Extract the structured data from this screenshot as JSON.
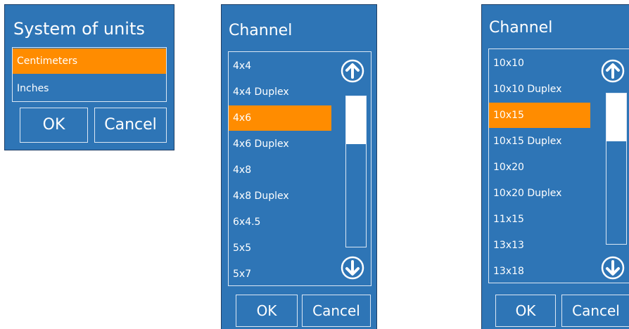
{
  "units_dialog": {
    "title": "System of units",
    "options": [
      {
        "label": "Centimeters",
        "selected": true
      },
      {
        "label": "Inches",
        "selected": false
      }
    ],
    "ok_label": "OK",
    "cancel_label": "Cancel"
  },
  "channel_dialog_1": {
    "title": "Channel",
    "items": [
      "4x4",
      "4x4 Duplex",
      "4x6",
      "4x6 Duplex",
      "4x8",
      "4x8 Duplex",
      "6x4.5",
      "5x5",
      "5x7"
    ],
    "selected_item": "4x6",
    "ok_label": "OK",
    "cancel_label": "Cancel",
    "scroll_up_icon": "arrow-up-circle-icon",
    "scroll_down_icon": "arrow-down-circle-icon"
  },
  "channel_dialog_2": {
    "title": "Channel",
    "items": [
      "10x10",
      "10x10 Duplex",
      "10x15",
      "10x15 Duplex",
      "10x20",
      "10x20 Duplex",
      "11x15",
      "13x13",
      "13x18"
    ],
    "selected_item": "10x15",
    "ok_label": "OK",
    "cancel_label": "Cancel",
    "scroll_up_icon": "arrow-up-circle-icon",
    "scroll_down_icon": "arrow-down-circle-icon"
  },
  "colors": {
    "dialog_bg": "#2e75b6",
    "selection": "#ff8c00",
    "text": "#ffffff",
    "border": "#dbe7f4"
  }
}
